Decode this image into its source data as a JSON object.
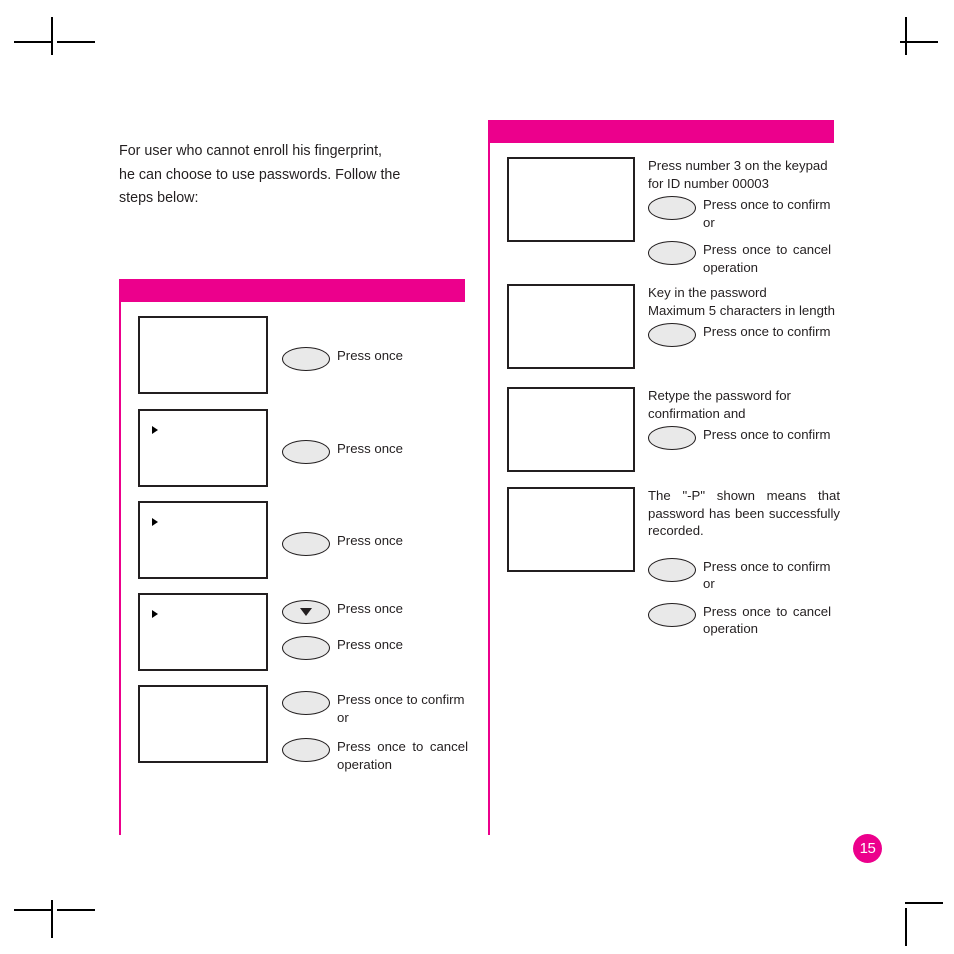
{
  "page": {
    "number": "15",
    "accent_color": "#ec008c",
    "text_color": "#231f20"
  },
  "intro": {
    "line1": "For user who cannot enroll his fingerprint,",
    "line2": "he can choose to use passwords. Follow the",
    "line3": "steps below:"
  },
  "left_column": {
    "heading_bar_label": "",
    "steps": [
      {
        "display_marker": false,
        "buttons": [
          {
            "icon": "oval-button",
            "label": "Press once"
          }
        ]
      },
      {
        "display_marker": true,
        "buttons": [
          {
            "icon": "oval-button",
            "label": "Press once"
          }
        ]
      },
      {
        "display_marker": true,
        "buttons": [
          {
            "icon": "oval-button",
            "label": "Press once"
          }
        ]
      },
      {
        "display_marker": true,
        "buttons": [
          {
            "icon": "oval-button-down-arrow",
            "label": "Press once"
          },
          {
            "icon": "oval-button",
            "label": "Press once"
          }
        ]
      },
      {
        "display_marker": false,
        "buttons": [
          {
            "icon": "oval-button",
            "label": "Press once to confirm or"
          },
          {
            "icon": "oval-button",
            "label": "Press once to cancel operation"
          }
        ]
      }
    ]
  },
  "right_column": {
    "heading_bar_label": "",
    "steps": [
      {
        "text": "Press number 3 on the keypad for ID number 00003",
        "buttons": [
          {
            "icon": "oval-button",
            "label": "Press once to confirm or"
          },
          {
            "icon": "oval-button",
            "label": "Press once to cancel operation"
          }
        ]
      },
      {
        "text_line1": "Key in the password",
        "text_line2": "Maximum 5 characters in length",
        "buttons": [
          {
            "icon": "oval-button",
            "label": "Press once to confirm"
          }
        ]
      },
      {
        "text": "Retype the password for confirmation and",
        "buttons": [
          {
            "icon": "oval-button",
            "label": "Press once to confirm"
          }
        ]
      },
      {
        "text": "The \"-P\" shown means that password has been successfully recorded.",
        "buttons": [
          {
            "icon": "oval-button",
            "label": "Press once to confirm or"
          },
          {
            "icon": "oval-button",
            "label": "Press once to cancel operation"
          }
        ]
      }
    ]
  }
}
